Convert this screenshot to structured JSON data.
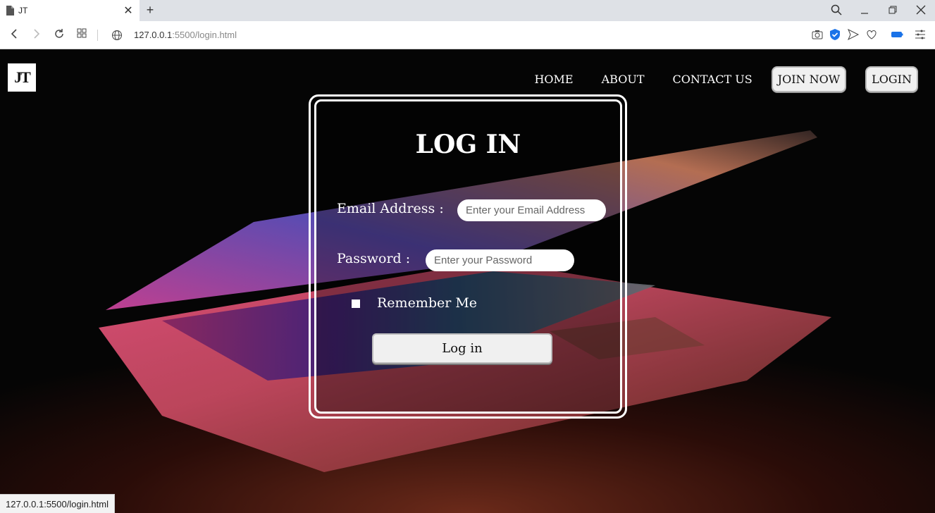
{
  "browser": {
    "tab_title": "JT",
    "new_tab_symbol": "+",
    "close_symbol": "✕",
    "url_host": "127.0.0.1",
    "url_rest": ":5500/login.html",
    "status_url": "127.0.0.1:5500/login.html",
    "icons": [
      "page-icon",
      "back-icon",
      "forward-icon",
      "reload-icon",
      "tabs-grid-icon",
      "globe-icon",
      "search-icon",
      "minimize-icon",
      "restore-icon",
      "window-close-icon",
      "camera-icon",
      "shield-icon",
      "send-icon",
      "heart-icon",
      "battery-icon",
      "menu-icon"
    ]
  },
  "site": {
    "logo_text": "JT",
    "nav": {
      "home": "HOME",
      "about": "ABOUT",
      "contact": "CONTACT US",
      "join": "JOIN NOW",
      "login": "LOGIN"
    }
  },
  "login": {
    "title": "LOG IN",
    "email_label": "Email Address :",
    "email_placeholder": "Enter your Email Address",
    "password_label": "Password :",
    "password_placeholder": "Enter your Password",
    "remember_label": "Remember Me",
    "submit_label": "Log in"
  },
  "colors": {
    "background": "#050505",
    "card_border": "#ffffff",
    "button_bg": "#f0f0f0"
  }
}
